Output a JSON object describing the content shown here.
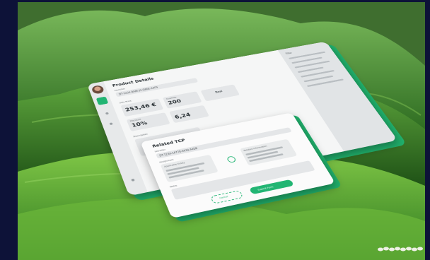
{
  "colors": {
    "frame": "#0d1238",
    "accent": "#22b573",
    "card": "#f5f6f6"
  },
  "back_panel": {
    "title": "Product Details",
    "id_label": "Identifier",
    "id_value": "DT-1234-8A8F32-D80E-A4F9",
    "price_label": "Sale Price",
    "price_value": "253,46 €",
    "qty_label": "Quantity",
    "qty_value": "200",
    "deal_value": "Deal",
    "discount_label": "Discount",
    "discount_value": "10%",
    "weight_value": "6,24",
    "description_label": "Description",
    "side_title": "Filter"
  },
  "front_panel": {
    "title": "Related TCP",
    "id_label": "Identifier",
    "id_value": "DT-1234-1A778-9A30-A4D8",
    "assign_label": "Assignment",
    "left_box_title": "Applicable Entity",
    "right_box_title": "Related Information",
    "notes_label": "Notes",
    "cancel_label": "Cancel",
    "submit_label": "Submit Form"
  }
}
